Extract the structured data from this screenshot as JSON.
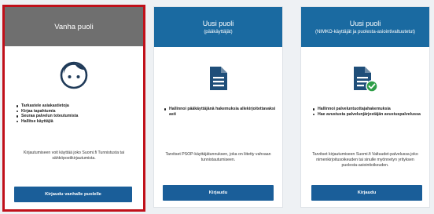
{
  "cards": [
    {
      "title": "Vanha puoli",
      "subtitle": "",
      "features": [
        "Tarkastele asiakastietoja",
        "Kirjaa tapahtumia",
        "Seuraa palvelun toteutumista",
        "Hallitse käyttäjiä"
      ],
      "info": "Kirjautumiseen voit käyttää joko Suomi.fi Tunnistusta tai sähköpostikirjautumista.",
      "button": "Kirjaudu vanhalle puolelle"
    },
    {
      "title": "Uusi puoli",
      "subtitle": "(pääkäyttäjät)",
      "features": [
        "Hallinnoi pääkäyttäjänä hakemuksia allekirjoitettavaksi asti"
      ],
      "info": "Tarvitset PSOP-käyttäjätunnuksen, joka on liitetty vahvaan tunnistautumiseen.",
      "button": "Kirjaudu"
    },
    {
      "title": "Uusi puoli",
      "subtitle": "(NIMKO-käyttäjät ja puolesta-asiointivaltuutetut)",
      "features": [
        "Hallinnoi palveluntuottajahakemuksia",
        "Hae avustusta palvelunjärjestäjän avustuspalvelussa"
      ],
      "info": "Tarvitset kirjautumiseen Suomi.fi Valtuudet-palvelussa joko nimenkirjoitusoikeuden tai sinulle myönnetyn yrityksen puolesta-asiointioikeuden.",
      "button": "Kirjaudu"
    }
  ],
  "icons": [
    "user-face-icon",
    "document-icon",
    "document-check-icon"
  ],
  "colors": {
    "header_old": "#6f6f6f",
    "header_new": "#1a6aa1",
    "button": "#1a5e99",
    "selected_border": "#c0101a",
    "check": "#2e9e47"
  }
}
